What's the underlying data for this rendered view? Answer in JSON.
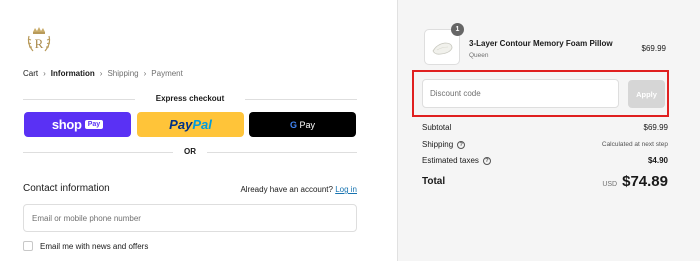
{
  "breadcrumb": {
    "items": [
      "Cart",
      "Information",
      "Shipping",
      "Payment"
    ],
    "separator": "›",
    "current_index": 1
  },
  "express": {
    "label": "Express checkout",
    "shop_pay": {
      "text": "shop",
      "badge": "Pay"
    },
    "paypal": {
      "pay": "Pay",
      "pal": "Pal"
    },
    "gpay": {
      "g": "G",
      "text": "Pay"
    },
    "or_label": "OR"
  },
  "contact": {
    "title": "Contact information",
    "account_prompt": "Already have an account?",
    "login_link": "Log in",
    "email_placeholder": "Email or mobile phone number",
    "newsletter_label": "Email me with news and offers"
  },
  "order": {
    "product": {
      "name": "3-Layer Contour Memory Foam Pillow",
      "variant": "Queen",
      "price": "$69.99",
      "quantity": "1"
    },
    "discount": {
      "placeholder": "Discount code",
      "apply_label": "Apply"
    },
    "subtotal": {
      "label": "Subtotal",
      "value": "$69.99"
    },
    "shipping": {
      "label": "Shipping",
      "value": "Calculated at next step"
    },
    "taxes": {
      "label": "Estimated taxes",
      "value": "$4.90"
    },
    "total": {
      "label": "Total",
      "currency": "USD",
      "value": "$74.89"
    }
  },
  "colors": {
    "shop_pay": "#5a31f4",
    "paypal": "#ffc439",
    "gpay": "#000000",
    "link": "#1773b0",
    "highlight": "#e02020"
  },
  "icons": [
    "logo-crest",
    "chevron-right-icon",
    "help-icon",
    "product-pillow-image"
  ]
}
